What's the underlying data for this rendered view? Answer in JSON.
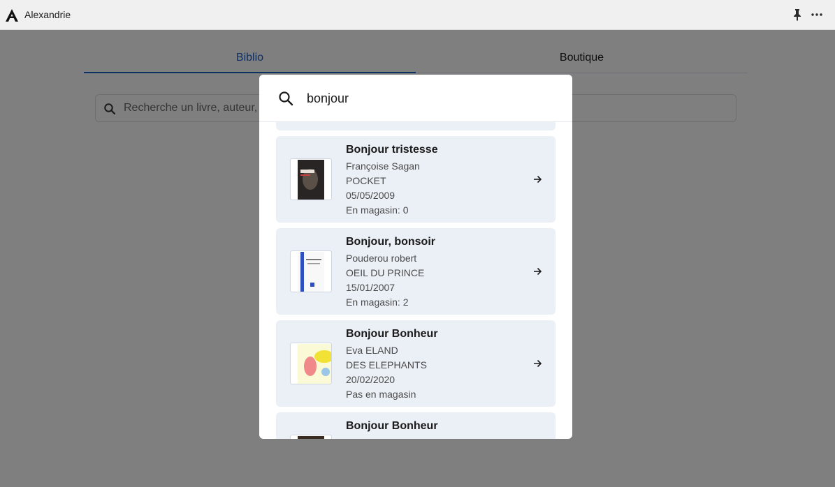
{
  "app": {
    "title": "Alexandrie"
  },
  "tabs": [
    {
      "label": "Biblio",
      "active": true
    },
    {
      "label": "Boutique",
      "active": false
    }
  ],
  "page_search": {
    "placeholder": "Recherche un livre, auteur,"
  },
  "modal_search": {
    "query": "bonjour"
  },
  "results": [
    {
      "title": "Bonjour tristesse",
      "author": "Françoise Sagan",
      "publisher": "POCKET",
      "date": "05/05/2009",
      "stock": "En magasin: 0"
    },
    {
      "title": "Bonjour, bonsoir",
      "author": "Pouderou robert",
      "publisher": "OEIL DU PRINCE",
      "date": "15/01/2007",
      "stock": "En magasin: 2"
    },
    {
      "title": "Bonjour Bonheur",
      "author": "Eva ELAND",
      "publisher": "DES ELEPHANTS",
      "date": "20/02/2020",
      "stock": "Pas en magasin"
    },
    {
      "title": "Bonjour Bonheur"
    }
  ],
  "colors": {
    "accent": "#1d5fc8",
    "card_bg": "#ebf0f7",
    "overlay": "rgba(0,0,0,0.5)"
  },
  "icons": {
    "logo": "alexandrie-logo-icon",
    "pin": "pin-icon",
    "more": "more-horizontal-icon",
    "search": "search-icon",
    "arrow": "arrow-right-icon"
  }
}
